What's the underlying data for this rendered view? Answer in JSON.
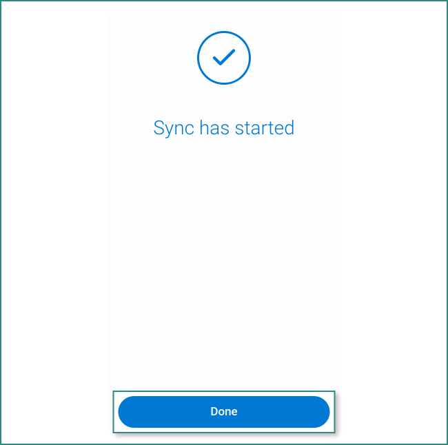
{
  "status": {
    "title": "Sync has started",
    "icon": "checkmark-circle"
  },
  "actions": {
    "done_label": "Done"
  },
  "colors": {
    "accent": "#0078d4",
    "frame": "#2a8b82"
  }
}
